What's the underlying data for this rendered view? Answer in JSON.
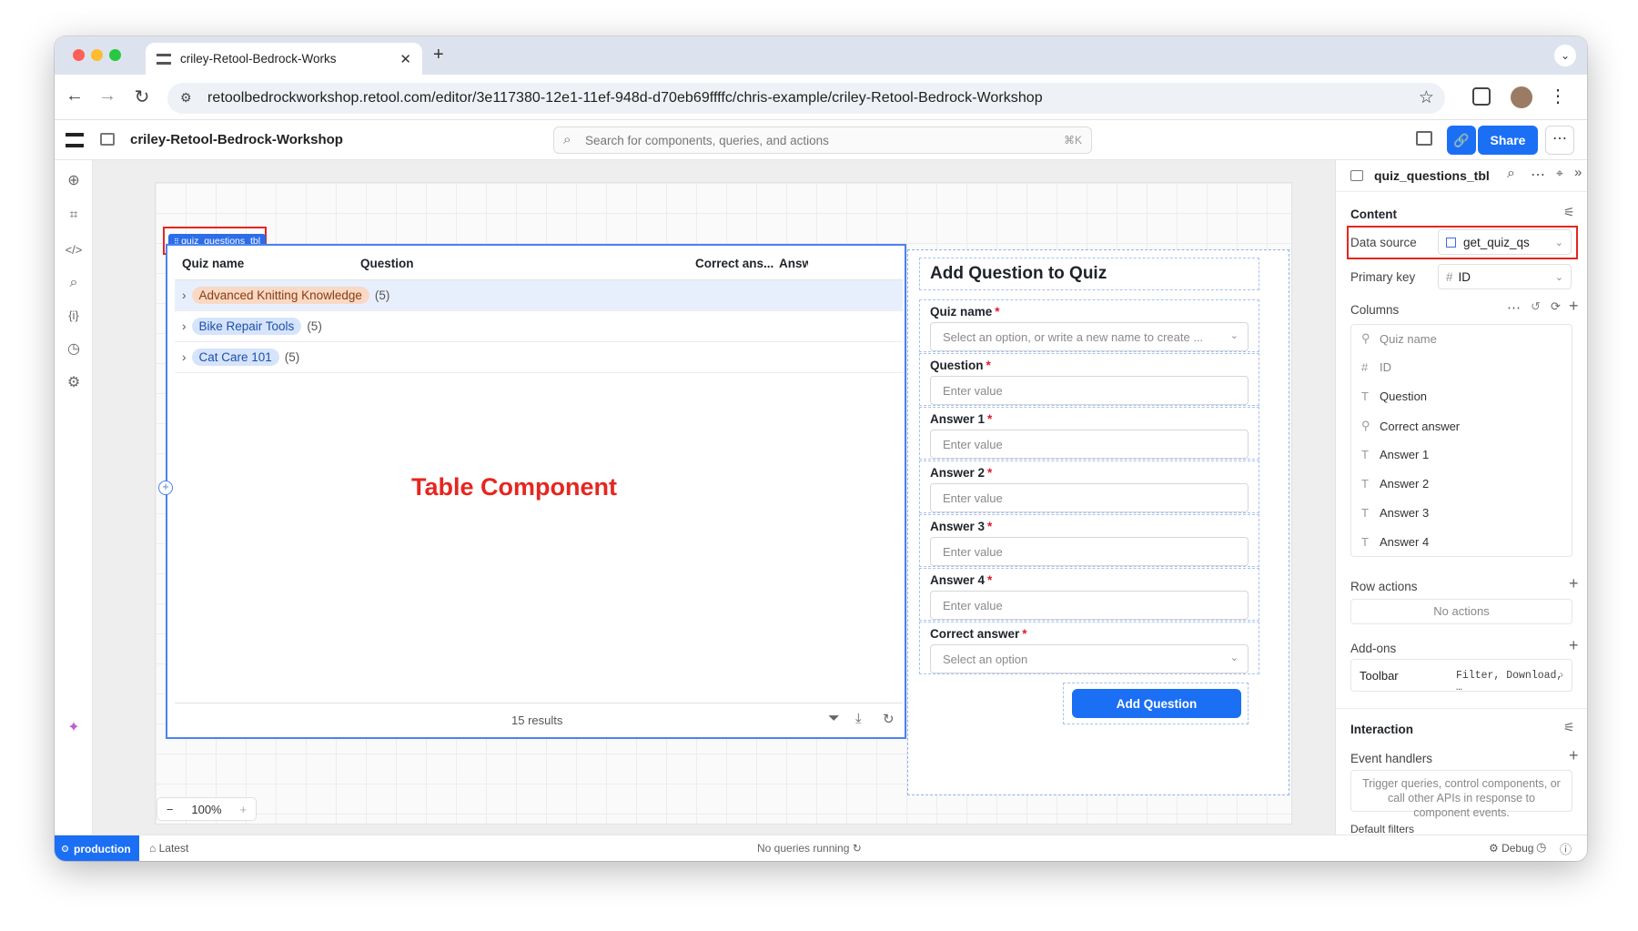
{
  "browser": {
    "tab_title": "criley-Retool-Bedrock-Works",
    "url": "retoolbedrockworkshop.retool.com/editor/3e117380-12e1-11ef-948d-d70eb69ffffc/chris-example/criley-Retool-Bedrock-Workshop"
  },
  "app": {
    "name": "criley-Retool-Bedrock-Workshop",
    "search_placeholder": "Search for components, queries, and actions",
    "search_shortcut": "⌘K",
    "share_label": "Share"
  },
  "canvas": {
    "component_tag": "quiz_questions_tbl",
    "annotation": "Table Component",
    "zoom": "100%"
  },
  "table": {
    "headers": [
      "Quiz name",
      "Question",
      "Correct ans...",
      "Answ"
    ],
    "groups": [
      {
        "name": "Advanced Knitting Knowledge",
        "count": "(5)",
        "color": "#f9d9c4",
        "text": "#8a3b12"
      },
      {
        "name": "Bike Repair Tools",
        "count": "(5)",
        "color": "#d6e4fb",
        "text": "#1c4fa8"
      },
      {
        "name": "Cat Care 101",
        "count": "(5)",
        "color": "#d6e4fb",
        "text": "#1c4fa8"
      }
    ],
    "results": "15 results"
  },
  "form": {
    "title": "Add Question to Quiz",
    "fields": [
      {
        "label": "Quiz name",
        "placeholder": "Select an option, or write a new name to create ..."
      },
      {
        "label": "Question",
        "placeholder": "Enter value"
      },
      {
        "label": "Answer 1",
        "placeholder": "Enter value"
      },
      {
        "label": "Answer 2",
        "placeholder": "Enter value"
      },
      {
        "label": "Answer 3",
        "placeholder": "Enter value"
      },
      {
        "label": "Answer 4",
        "placeholder": "Enter value"
      },
      {
        "label": "Correct answer",
        "placeholder": "Select an option"
      }
    ],
    "submit": "Add Question",
    "required_mark": "*"
  },
  "inspector": {
    "component": "quiz_questions_tbl",
    "content": "Content",
    "data_source_label": "Data source",
    "data_source": "get_quiz_qs",
    "primary_key_label": "Primary key",
    "primary_key": "ID",
    "columns_label": "Columns",
    "columns": [
      {
        "icon": "⚲",
        "name": "Quiz name",
        "muted": true
      },
      {
        "icon": "#",
        "name": "ID",
        "muted": true
      },
      {
        "icon": "T",
        "name": "Question"
      },
      {
        "icon": "⚲",
        "name": "Correct answer"
      },
      {
        "icon": "T",
        "name": "Answer 1"
      },
      {
        "icon": "T",
        "name": "Answer 2"
      },
      {
        "icon": "T",
        "name": "Answer 3"
      },
      {
        "icon": "T",
        "name": "Answer 4"
      }
    ],
    "row_actions": "Row actions",
    "no_actions": "No actions",
    "addons": "Add-ons",
    "toolbar": "Toolbar",
    "toolbar_value": "Filter, Download, …",
    "interaction": "Interaction",
    "event_handlers": "Event handlers",
    "event_hint": "Trigger queries, control components, or call other APIs in response to component events.",
    "default_filters": "Default filters"
  },
  "status": {
    "env": "production",
    "release": "Latest",
    "queries": "No queries running",
    "debug": "Debug"
  }
}
